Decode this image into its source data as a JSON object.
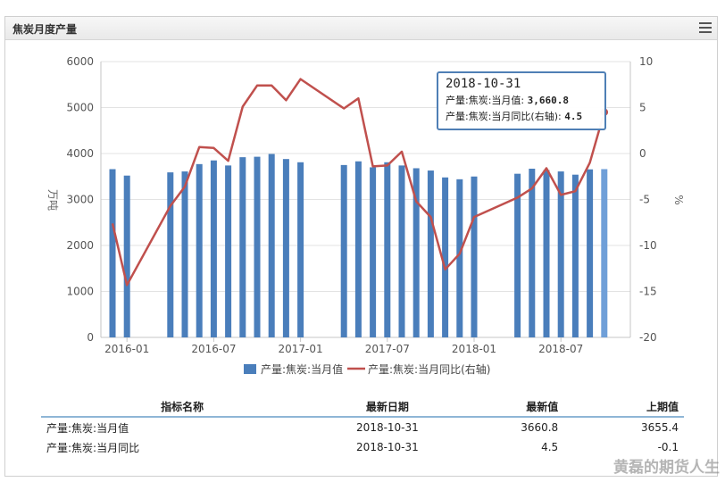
{
  "panel": {
    "title": "焦炭月度产量"
  },
  "chart_data": {
    "type": "bar+line",
    "y_left": {
      "label": "万吨",
      "min": 0,
      "max": 6000,
      "ticks": [
        0,
        1000,
        2000,
        3000,
        4000,
        5000,
        6000
      ]
    },
    "y_right": {
      "label": "%",
      "min": -20,
      "max": 10,
      "ticks": [
        -20,
        -15,
        -10,
        -5,
        0,
        5,
        10
      ]
    },
    "x_ticks": [
      "2016-01",
      "2016-07",
      "2017-01",
      "2017-07",
      "2018-01",
      "2018-07"
    ],
    "grid": true,
    "legend_position": "bottom",
    "series": [
      {
        "name": "产量:焦炭:当月值",
        "type": "bar",
        "axis": "left",
        "color": "#4a7ebb",
        "points": [
          [
            "2015-12",
            3660
          ],
          [
            "2016-01",
            3520
          ],
          [
            "2016-04",
            3590
          ],
          [
            "2016-05",
            3610
          ],
          [
            "2016-06",
            3770
          ],
          [
            "2016-07",
            3850
          ],
          [
            "2016-08",
            3740
          ],
          [
            "2016-09",
            3920
          ],
          [
            "2016-10",
            3930
          ],
          [
            "2016-11",
            3990
          ],
          [
            "2016-12",
            3880
          ],
          [
            "2017-01",
            3810
          ],
          [
            "2017-04",
            3750
          ],
          [
            "2017-05",
            3830
          ],
          [
            "2017-06",
            3700
          ],
          [
            "2017-07",
            3810
          ],
          [
            "2017-08",
            3740
          ],
          [
            "2017-09",
            3680
          ],
          [
            "2017-10",
            3630
          ],
          [
            "2017-11",
            3480
          ],
          [
            "2017-12",
            3440
          ],
          [
            "2018-01",
            3500
          ],
          [
            "2018-04",
            3560
          ],
          [
            "2018-05",
            3670
          ],
          [
            "2018-06",
            3640
          ],
          [
            "2018-07",
            3610
          ],
          [
            "2018-08",
            3540
          ],
          [
            "2018-09",
            3655.4
          ],
          [
            "2018-10",
            3660.8
          ]
        ]
      },
      {
        "name": "产量:焦炭:当月同比(右轴)",
        "type": "line",
        "axis": "right",
        "color": "#c0504d",
        "points": [
          [
            "2015-12",
            -7.6
          ],
          [
            "2016-01",
            -14.3
          ],
          [
            "2016-04",
            -5.7
          ],
          [
            "2016-05",
            -3.6
          ],
          [
            "2016-06",
            0.7
          ],
          [
            "2016-07",
            0.6
          ],
          [
            "2016-08",
            -0.8
          ],
          [
            "2016-09",
            5.1
          ],
          [
            "2016-10",
            7.4
          ],
          [
            "2016-11",
            7.4
          ],
          [
            "2016-12",
            5.8
          ],
          [
            "2017-01",
            8.1
          ],
          [
            "2017-04",
            4.9
          ],
          [
            "2017-05",
            6.0
          ],
          [
            "2017-06",
            -1.4
          ],
          [
            "2017-07",
            -1.3
          ],
          [
            "2017-08",
            0.2
          ],
          [
            "2017-09",
            -5.2
          ],
          [
            "2017-10",
            -6.9
          ],
          [
            "2017-11",
            -12.6
          ],
          [
            "2017-12",
            -10.9
          ],
          [
            "2018-01",
            -6.9
          ],
          [
            "2018-04",
            -4.8
          ],
          [
            "2018-05",
            -3.8
          ],
          [
            "2018-06",
            -1.6
          ],
          [
            "2018-07",
            -4.5
          ],
          [
            "2018-08",
            -4.1
          ],
          [
            "2018-09",
            -1.0
          ],
          [
            "2018-10",
            4.5
          ]
        ]
      }
    ]
  },
  "tooltip": {
    "date": "2018-10-31",
    "row1_label": "产量:焦炭:当月值:",
    "row1_value": "3,660.8",
    "row2_label": "产量:焦炭:当月同比(右轴):",
    "row2_value": "4.5"
  },
  "table": {
    "headers": [
      "指标名称",
      "最新日期",
      "最新值",
      "上期值"
    ],
    "rows": [
      [
        "产量:焦炭:当月值",
        "2018-10-31",
        "3660.8",
        "3655.4"
      ],
      [
        "产量:焦炭:当月同比",
        "2018-10-31",
        "4.5",
        "-0.1"
      ]
    ]
  },
  "watermark": "黄磊的期货人生"
}
